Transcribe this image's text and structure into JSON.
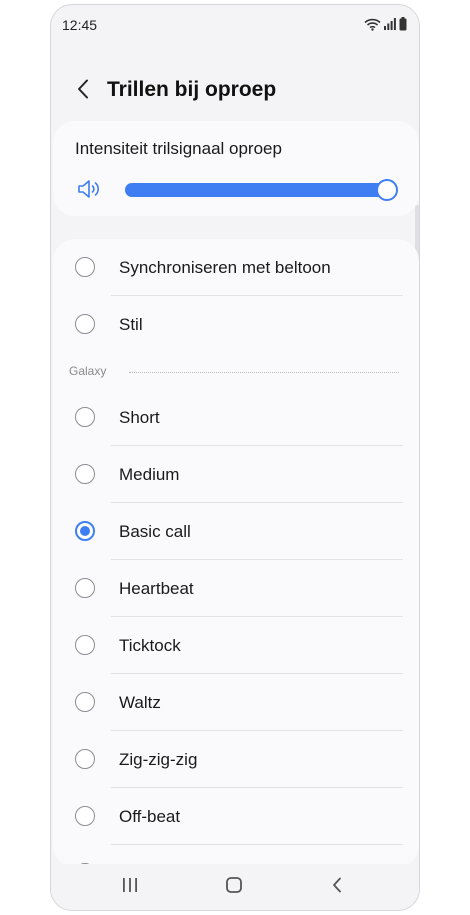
{
  "status_bar": {
    "time": "12:45"
  },
  "app_bar": {
    "title": "Trillen bij oproep"
  },
  "intensity": {
    "label": "Intensiteit trilsignaal oproep",
    "level": 1.0
  },
  "options_top": [
    {
      "label": "Synchroniseren met beltoon",
      "selected": false
    },
    {
      "label": "Stil",
      "selected": false
    }
  ],
  "galaxy_section": {
    "title": "Galaxy"
  },
  "options_galaxy": [
    {
      "label": "Short",
      "selected": false
    },
    {
      "label": "Medium",
      "selected": false
    },
    {
      "label": "Basic call",
      "selected": true
    },
    {
      "label": "Heartbeat",
      "selected": false
    },
    {
      "label": "Ticktock",
      "selected": false
    },
    {
      "label": "Waltz",
      "selected": false
    },
    {
      "label": "Zig-zig-zig",
      "selected": false
    },
    {
      "label": "Off-beat",
      "selected": false
    }
  ],
  "colors": {
    "accent": "#3e7ef2"
  }
}
